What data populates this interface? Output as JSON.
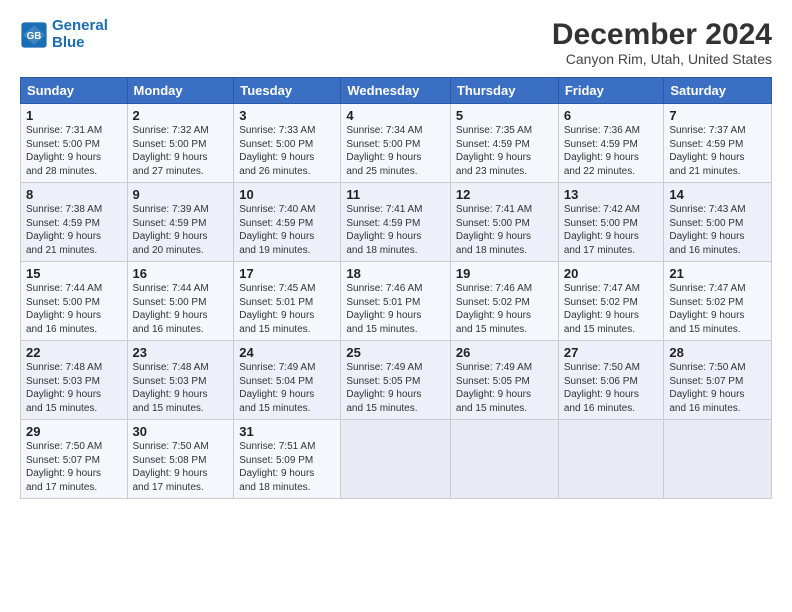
{
  "logo": {
    "line1": "General",
    "line2": "Blue"
  },
  "title": "December 2024",
  "subtitle": "Canyon Rim, Utah, United States",
  "header_days": [
    "Sunday",
    "Monday",
    "Tuesday",
    "Wednesday",
    "Thursday",
    "Friday",
    "Saturday"
  ],
  "weeks": [
    [
      {
        "day": "1",
        "info": "Sunrise: 7:31 AM\nSunset: 5:00 PM\nDaylight: 9 hours\nand 28 minutes."
      },
      {
        "day": "2",
        "info": "Sunrise: 7:32 AM\nSunset: 5:00 PM\nDaylight: 9 hours\nand 27 minutes."
      },
      {
        "day": "3",
        "info": "Sunrise: 7:33 AM\nSunset: 5:00 PM\nDaylight: 9 hours\nand 26 minutes."
      },
      {
        "day": "4",
        "info": "Sunrise: 7:34 AM\nSunset: 5:00 PM\nDaylight: 9 hours\nand 25 minutes."
      },
      {
        "day": "5",
        "info": "Sunrise: 7:35 AM\nSunset: 4:59 PM\nDaylight: 9 hours\nand 23 minutes."
      },
      {
        "day": "6",
        "info": "Sunrise: 7:36 AM\nSunset: 4:59 PM\nDaylight: 9 hours\nand 22 minutes."
      },
      {
        "day": "7",
        "info": "Sunrise: 7:37 AM\nSunset: 4:59 PM\nDaylight: 9 hours\nand 21 minutes."
      }
    ],
    [
      {
        "day": "8",
        "info": "Sunrise: 7:38 AM\nSunset: 4:59 PM\nDaylight: 9 hours\nand 21 minutes."
      },
      {
        "day": "9",
        "info": "Sunrise: 7:39 AM\nSunset: 4:59 PM\nDaylight: 9 hours\nand 20 minutes."
      },
      {
        "day": "10",
        "info": "Sunrise: 7:40 AM\nSunset: 4:59 PM\nDaylight: 9 hours\nand 19 minutes."
      },
      {
        "day": "11",
        "info": "Sunrise: 7:41 AM\nSunset: 4:59 PM\nDaylight: 9 hours\nand 18 minutes."
      },
      {
        "day": "12",
        "info": "Sunrise: 7:41 AM\nSunset: 5:00 PM\nDaylight: 9 hours\nand 18 minutes."
      },
      {
        "day": "13",
        "info": "Sunrise: 7:42 AM\nSunset: 5:00 PM\nDaylight: 9 hours\nand 17 minutes."
      },
      {
        "day": "14",
        "info": "Sunrise: 7:43 AM\nSunset: 5:00 PM\nDaylight: 9 hours\nand 16 minutes."
      }
    ],
    [
      {
        "day": "15",
        "info": "Sunrise: 7:44 AM\nSunset: 5:00 PM\nDaylight: 9 hours\nand 16 minutes."
      },
      {
        "day": "16",
        "info": "Sunrise: 7:44 AM\nSunset: 5:00 PM\nDaylight: 9 hours\nand 16 minutes."
      },
      {
        "day": "17",
        "info": "Sunrise: 7:45 AM\nSunset: 5:01 PM\nDaylight: 9 hours\nand 15 minutes."
      },
      {
        "day": "18",
        "info": "Sunrise: 7:46 AM\nSunset: 5:01 PM\nDaylight: 9 hours\nand 15 minutes."
      },
      {
        "day": "19",
        "info": "Sunrise: 7:46 AM\nSunset: 5:02 PM\nDaylight: 9 hours\nand 15 minutes."
      },
      {
        "day": "20",
        "info": "Sunrise: 7:47 AM\nSunset: 5:02 PM\nDaylight: 9 hours\nand 15 minutes."
      },
      {
        "day": "21",
        "info": "Sunrise: 7:47 AM\nSunset: 5:02 PM\nDaylight: 9 hours\nand 15 minutes."
      }
    ],
    [
      {
        "day": "22",
        "info": "Sunrise: 7:48 AM\nSunset: 5:03 PM\nDaylight: 9 hours\nand 15 minutes."
      },
      {
        "day": "23",
        "info": "Sunrise: 7:48 AM\nSunset: 5:03 PM\nDaylight: 9 hours\nand 15 minutes."
      },
      {
        "day": "24",
        "info": "Sunrise: 7:49 AM\nSunset: 5:04 PM\nDaylight: 9 hours\nand 15 minutes."
      },
      {
        "day": "25",
        "info": "Sunrise: 7:49 AM\nSunset: 5:05 PM\nDaylight: 9 hours\nand 15 minutes."
      },
      {
        "day": "26",
        "info": "Sunrise: 7:49 AM\nSunset: 5:05 PM\nDaylight: 9 hours\nand 15 minutes."
      },
      {
        "day": "27",
        "info": "Sunrise: 7:50 AM\nSunset: 5:06 PM\nDaylight: 9 hours\nand 16 minutes."
      },
      {
        "day": "28",
        "info": "Sunrise: 7:50 AM\nSunset: 5:07 PM\nDaylight: 9 hours\nand 16 minutes."
      }
    ],
    [
      {
        "day": "29",
        "info": "Sunrise: 7:50 AM\nSunset: 5:07 PM\nDaylight: 9 hours\nand 17 minutes."
      },
      {
        "day": "30",
        "info": "Sunrise: 7:50 AM\nSunset: 5:08 PM\nDaylight: 9 hours\nand 17 minutes."
      },
      {
        "day": "31",
        "info": "Sunrise: 7:51 AM\nSunset: 5:09 PM\nDaylight: 9 hours\nand 18 minutes."
      },
      {
        "day": "",
        "info": ""
      },
      {
        "day": "",
        "info": ""
      },
      {
        "day": "",
        "info": ""
      },
      {
        "day": "",
        "info": ""
      }
    ]
  ]
}
